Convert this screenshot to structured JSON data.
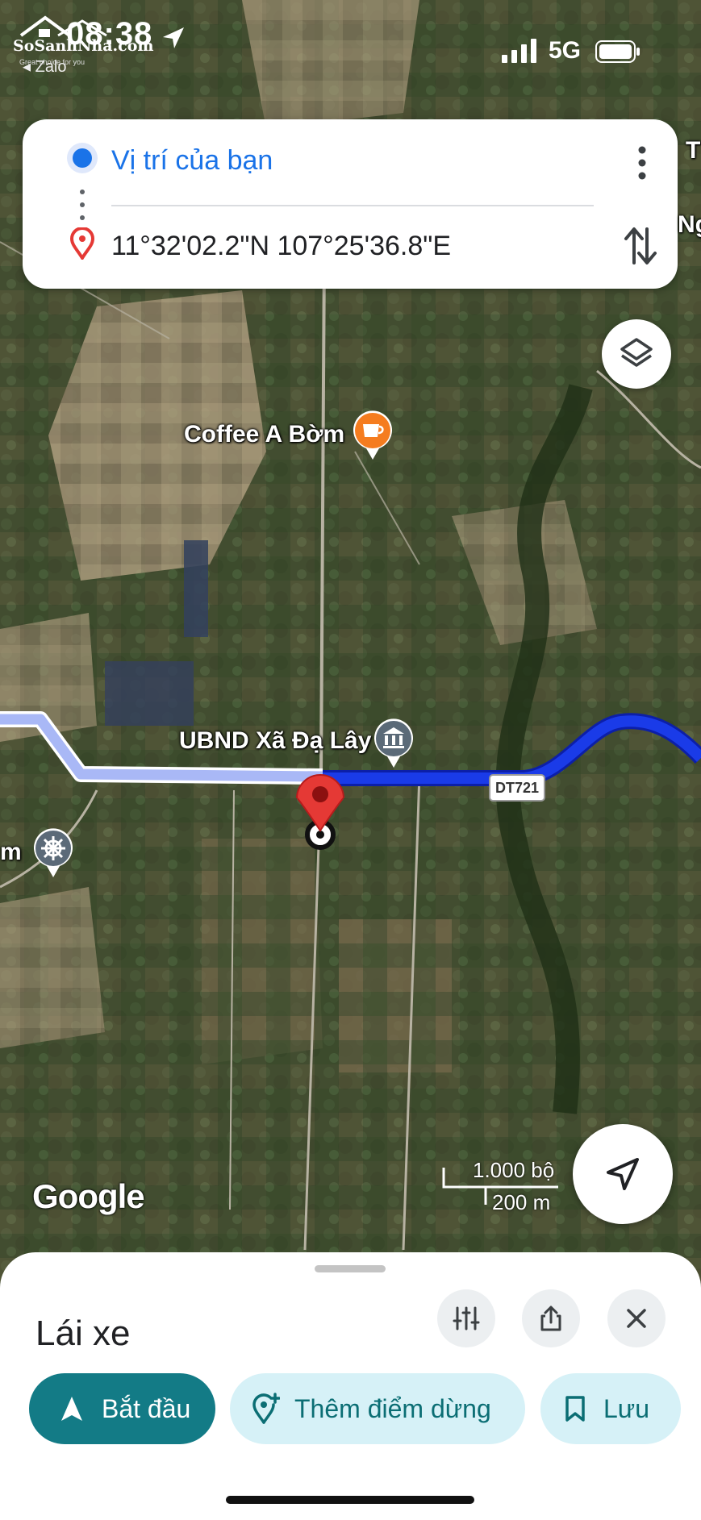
{
  "status_bar": {
    "time": "08:38",
    "back_app": "◂ Zalo",
    "network": "5G"
  },
  "watermark": {
    "brand": "SoSanhNha.com",
    "tagline": "Great choice for you"
  },
  "directions_card": {
    "from": "Vị trí của bạn",
    "to": "11°32'02.2\"N 107°25'36.8\"E"
  },
  "map": {
    "poi": [
      {
        "name": "Coffee A Bờm",
        "icon": "coffee-cup-icon",
        "color": "#f57c1f"
      },
      {
        "name": "UBND Xã Đạ Lây",
        "icon": "government-building-icon",
        "color": "#5b6a78"
      },
      {
        "name": "m",
        "icon": "ship-wheel-icon",
        "color": "#5b6a78"
      }
    ],
    "road_label": "DT721",
    "edge_labels": [
      "T",
      "Ng"
    ],
    "route_color": "#1a3be8",
    "traveled_route_color": "#a9b8f6",
    "destination_pin_color": "#e53935",
    "google_logo": "Google",
    "scale": {
      "imperial": "1.000 bộ",
      "metric": "200 m"
    }
  },
  "bottom_sheet": {
    "mode": "Lái xe",
    "start_label": "Bắt đầu",
    "add_stop_label": "Thêm điểm dừng",
    "save_label": "Lưu"
  }
}
